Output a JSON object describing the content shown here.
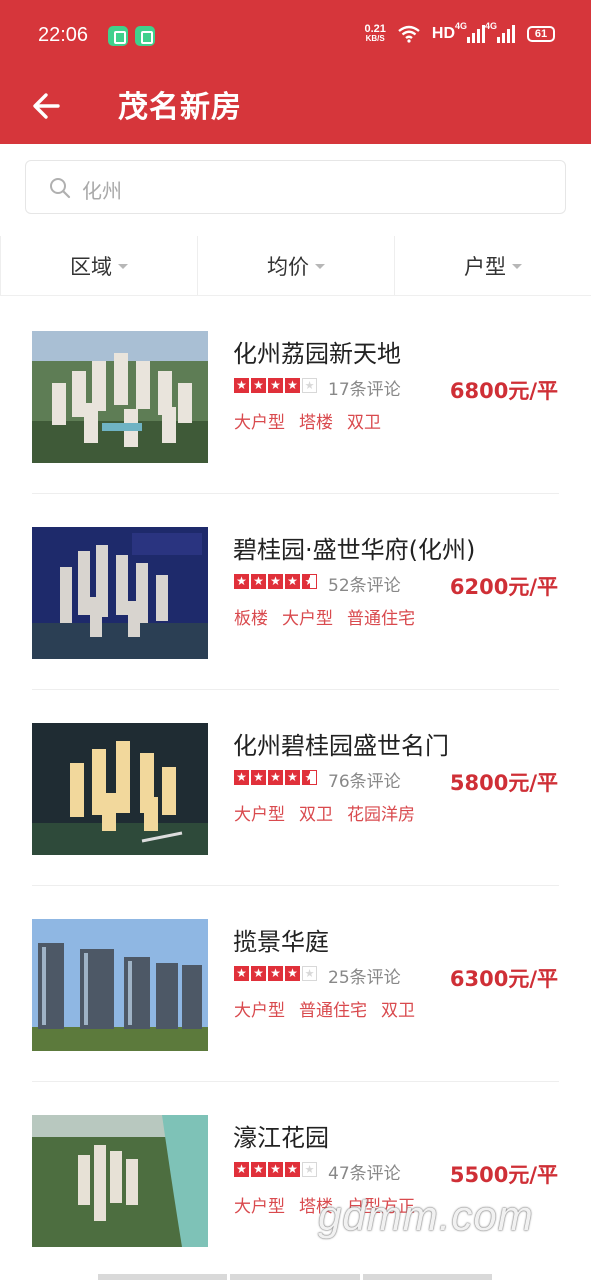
{
  "status_bar": {
    "time": "22:06",
    "speed_top": "0.21",
    "speed_bottom": "KB/S",
    "hd": "HD",
    "sig1": "4G",
    "sig2": "4G",
    "battery": "61"
  },
  "header": {
    "title": "茂名新房"
  },
  "search": {
    "placeholder": "化州"
  },
  "filters": [
    {
      "label": "区域"
    },
    {
      "label": "均价"
    },
    {
      "label": "户型"
    }
  ],
  "listings": [
    {
      "name": "化州荔园新天地",
      "rating": 4,
      "reviews": "17条评论",
      "price": "6800元/平",
      "tags": [
        "大户型",
        "塔楼",
        "双卫"
      ]
    },
    {
      "name": "碧桂园·盛世华府(化州)",
      "rating": 4.5,
      "reviews": "52条评论",
      "price": "6200元/平",
      "tags": [
        "板楼",
        "大户型",
        "普通住宅"
      ]
    },
    {
      "name": "化州碧桂园盛世名门",
      "rating": 4.5,
      "reviews": "76条评论",
      "price": "5800元/平",
      "tags": [
        "大户型",
        "双卫",
        "花园洋房"
      ]
    },
    {
      "name": "揽景华庭",
      "rating": 4,
      "reviews": "25条评论",
      "price": "6300元/平",
      "tags": [
        "大户型",
        "普通住宅",
        "双卫"
      ]
    },
    {
      "name": "濠江花园",
      "rating": 4,
      "reviews": "47条评论",
      "price": "5500元/平",
      "tags": [
        "大户型",
        "塔楼",
        "户型方正"
      ]
    }
  ],
  "watermark": "gdmm.com",
  "colors": {
    "primary": "#d6363b",
    "price": "#cf2f36",
    "tag": "#d94a4e"
  }
}
